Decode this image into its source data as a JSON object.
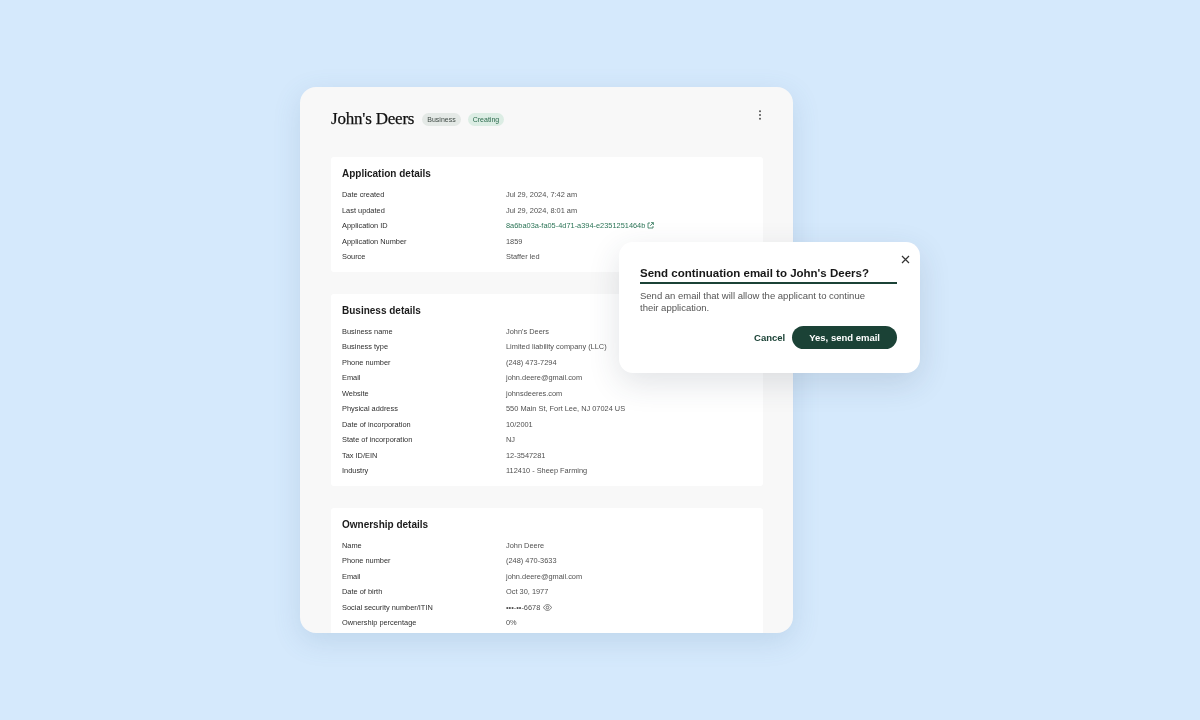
{
  "header": {
    "title": "John's Deers",
    "badges": [
      {
        "label": "Business",
        "kind": "neutral"
      },
      {
        "label": "Creating",
        "kind": "success"
      }
    ]
  },
  "sections": [
    {
      "title": "Application details",
      "fields": [
        {
          "label": "Date created",
          "value": "Jul 29, 2024, 7:42 am",
          "kind": "text"
        },
        {
          "label": "Last updated",
          "value": "Jul 29, 2024, 8:01 am",
          "kind": "text"
        },
        {
          "label": "Application ID",
          "value": "8a6ba03a-fa05-4d71-a394-e2351251464b",
          "kind": "link"
        },
        {
          "label": "Application Number",
          "value": "1859",
          "kind": "text"
        },
        {
          "label": "Source",
          "value": "Staffer led",
          "kind": "text"
        }
      ]
    },
    {
      "title": "Business details",
      "fields": [
        {
          "label": "Business name",
          "value": "John's Deers",
          "kind": "text"
        },
        {
          "label": "Business type",
          "value": "Limited liability company (LLC)",
          "kind": "text"
        },
        {
          "label": "Phone number",
          "value": "(248) 473-7294",
          "kind": "text"
        },
        {
          "label": "Email",
          "value": "john.deere@gmail.com",
          "kind": "text"
        },
        {
          "label": "Website",
          "value": "johnsdeeres.com",
          "kind": "text"
        },
        {
          "label": "Physical address",
          "value": "550 Main St, Fort Lee, NJ 07024 US",
          "kind": "text"
        },
        {
          "label": "Date of incorporation",
          "value": "10/2001",
          "kind": "text"
        },
        {
          "label": "State of incorporation",
          "value": "NJ",
          "kind": "text"
        },
        {
          "label": "Tax ID/EIN",
          "value": "12-3547281",
          "kind": "text"
        },
        {
          "label": "Industry",
          "value": "112410 - Sheep Farming",
          "kind": "text"
        }
      ]
    },
    {
      "title": "Ownership details",
      "fields": [
        {
          "label": "Name",
          "value": "John Deere",
          "kind": "text"
        },
        {
          "label": "Phone number",
          "value": "(248) 470-3633",
          "kind": "text"
        },
        {
          "label": "Email",
          "value": "john.deere@gmail.com",
          "kind": "text"
        },
        {
          "label": "Date of birth",
          "value": "Oct 30, 1977",
          "kind": "text"
        },
        {
          "label": "Social security number/ITIN",
          "value": "•••-••-6678",
          "kind": "masked"
        },
        {
          "label": "Ownership percentage",
          "value": "0%",
          "kind": "text"
        }
      ]
    }
  ],
  "dialog": {
    "title": "Send continuation email to John's Deers?",
    "message": "Send an email that will allow the applicant to continue their application.",
    "buttons": [
      {
        "label": "Cancel",
        "kind": "secondary"
      },
      {
        "label": "Yes, send email",
        "kind": "primary"
      }
    ]
  }
}
